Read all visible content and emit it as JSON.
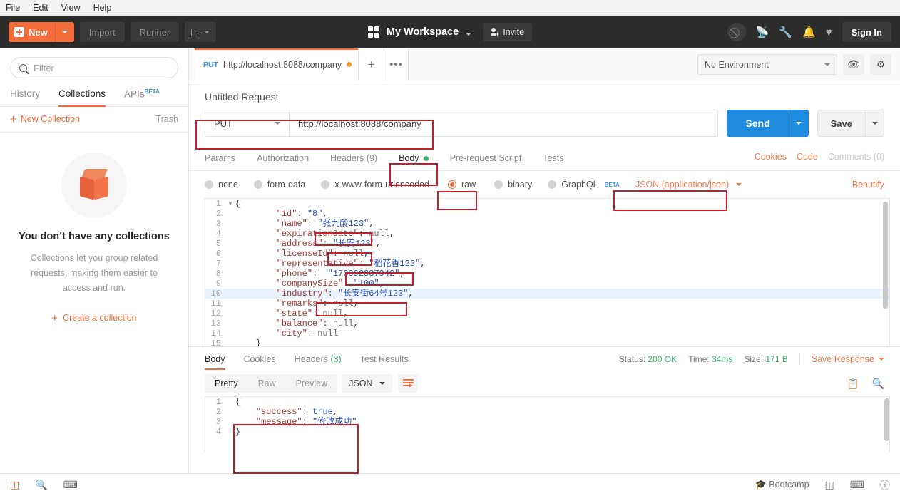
{
  "menubar": {
    "items": [
      "File",
      "Edit",
      "View",
      "Help"
    ]
  },
  "header": {
    "new_label": "New",
    "import_label": "Import",
    "runner_label": "Runner",
    "workspace_label": "My Workspace",
    "invite_label": "Invite",
    "signin_label": "Sign In",
    "icons": [
      "sync-disabled-icon",
      "satellite-icon",
      "wrench-icon",
      "bell-icon",
      "heart-icon"
    ]
  },
  "sidebar": {
    "filter_placeholder": "Filter",
    "tabs": [
      {
        "label": "History",
        "active": false
      },
      {
        "label": "Collections",
        "active": true
      },
      {
        "label": "APIs",
        "badge": "BETA",
        "active": false
      }
    ],
    "new_collection_label": "New Collection",
    "trash_label": "Trash",
    "empty_title": "You don’t have any collections",
    "empty_body": "Collections let you group related requests, making them easier to access and run.",
    "create_label": "Create a collection"
  },
  "tabbar": {
    "request_tab": {
      "method": "PUT",
      "url": "http://localhost:8088/company",
      "unsaved": true
    },
    "add_label": "+",
    "more_label": "•••",
    "environment": "No Environment",
    "eye_icon": "eye-icon",
    "gear_icon": "gear-icon"
  },
  "request": {
    "name": "Untitled Request",
    "method": "PUT",
    "url": "http://localhost:8088/company",
    "send_label": "Send",
    "save_label": "Save",
    "tabs": [
      {
        "label": "Params",
        "active": false
      },
      {
        "label": "Authorization",
        "active": false
      },
      {
        "label": "Headers",
        "count": "(9)",
        "active": false
      },
      {
        "label": "Body",
        "active": true,
        "dot": true
      },
      {
        "label": "Pre-request Script",
        "active": false
      },
      {
        "label": "Tests",
        "active": false
      }
    ],
    "right_links": [
      {
        "label": "Cookies",
        "muted": false
      },
      {
        "label": "Code",
        "muted": false
      },
      {
        "label": "Comments (0)",
        "muted": true
      }
    ],
    "body_types": [
      {
        "label": "none",
        "selected": false
      },
      {
        "label": "form-data",
        "selected": false
      },
      {
        "label": "x-www-form-urlencoded",
        "selected": false
      },
      {
        "label": "raw",
        "selected": true
      },
      {
        "label": "binary",
        "selected": false
      },
      {
        "label": "GraphQL",
        "badge": "BETA",
        "selected": false
      }
    ],
    "content_type": "JSON (application/json)",
    "beautify_label": "Beautify",
    "body_lines": [
      {
        "n": "1",
        "fold": "▾",
        "segs": [
          {
            "t": "{",
            "c": "p"
          }
        ]
      },
      {
        "n": "2",
        "segs": [
          {
            "t": "        ",
            "c": "p"
          },
          {
            "t": "\"id\"",
            "c": "k"
          },
          {
            "t": ": ",
            "c": "p"
          },
          {
            "t": "\"8\"",
            "c": "s"
          },
          {
            "t": ",",
            "c": "p"
          }
        ]
      },
      {
        "n": "3",
        "segs": [
          {
            "t": "        ",
            "c": "p"
          },
          {
            "t": "\"name\"",
            "c": "k"
          },
          {
            "t": ": ",
            "c": "p"
          },
          {
            "t": "\"张九龄123\"",
            "c": "s"
          },
          {
            "t": ",",
            "c": "p"
          }
        ]
      },
      {
        "n": "4",
        "segs": [
          {
            "t": "        ",
            "c": "p"
          },
          {
            "t": "\"expirationDate\"",
            "c": "k"
          },
          {
            "t": ": ",
            "c": "p"
          },
          {
            "t": "null",
            "c": "n"
          },
          {
            "t": ",",
            "c": "p"
          }
        ]
      },
      {
        "n": "5",
        "segs": [
          {
            "t": "        ",
            "c": "p"
          },
          {
            "t": "\"address\"",
            "c": "k"
          },
          {
            "t": ": ",
            "c": "p"
          },
          {
            "t": "\"长安123\"",
            "c": "s"
          },
          {
            "t": ",",
            "c": "p"
          }
        ]
      },
      {
        "n": "6",
        "segs": [
          {
            "t": "        ",
            "c": "p"
          },
          {
            "t": "\"licenseId\"",
            "c": "k"
          },
          {
            "t": ": ",
            "c": "p"
          },
          {
            "t": "null",
            "c": "n"
          },
          {
            "t": ",",
            "c": "p"
          }
        ]
      },
      {
        "n": "7",
        "segs": [
          {
            "t": "        ",
            "c": "p"
          },
          {
            "t": "\"representative\"",
            "c": "k"
          },
          {
            "t": ": ",
            "c": "p"
          },
          {
            "t": "\"稻花香123\"",
            "c": "s"
          },
          {
            "t": ",",
            "c": "p"
          }
        ]
      },
      {
        "n": "8",
        "segs": [
          {
            "t": "        ",
            "c": "p"
          },
          {
            "t": "\"phone\"",
            "c": "k"
          },
          {
            "t": ":  ",
            "c": "p"
          },
          {
            "t": "\"173092387942\"",
            "c": "s"
          },
          {
            "t": ",",
            "c": "p"
          }
        ]
      },
      {
        "n": "9",
        "segs": [
          {
            "t": "        ",
            "c": "p"
          },
          {
            "t": "\"companySize\"",
            "c": "k"
          },
          {
            "t": ": ",
            "c": "p"
          },
          {
            "t": "\"100\"",
            "c": "s"
          },
          {
            "t": ",",
            "c": "p"
          }
        ]
      },
      {
        "n": "10",
        "hl": true,
        "segs": [
          {
            "t": "        ",
            "c": "p"
          },
          {
            "t": "\"industry\"",
            "c": "k"
          },
          {
            "t": ": ",
            "c": "p"
          },
          {
            "t": "\"长安街64号123\"",
            "c": "s"
          },
          {
            "t": ",",
            "c": "p"
          }
        ]
      },
      {
        "n": "11",
        "segs": [
          {
            "t": "        ",
            "c": "p"
          },
          {
            "t": "\"remarks\"",
            "c": "k"
          },
          {
            "t": ": ",
            "c": "p"
          },
          {
            "t": "null",
            "c": "n"
          },
          {
            "t": ",",
            "c": "p"
          }
        ]
      },
      {
        "n": "12",
        "segs": [
          {
            "t": "        ",
            "c": "p"
          },
          {
            "t": "\"state\"",
            "c": "k"
          },
          {
            "t": ": ",
            "c": "p"
          },
          {
            "t": "null",
            "c": "n"
          },
          {
            "t": ",",
            "c": "p"
          }
        ]
      },
      {
        "n": "13",
        "segs": [
          {
            "t": "        ",
            "c": "p"
          },
          {
            "t": "\"balance\"",
            "c": "k"
          },
          {
            "t": ": ",
            "c": "p"
          },
          {
            "t": "null",
            "c": "n"
          },
          {
            "t": ",",
            "c": "p"
          }
        ]
      },
      {
        "n": "14",
        "segs": [
          {
            "t": "        ",
            "c": "p"
          },
          {
            "t": "\"city\"",
            "c": "k"
          },
          {
            "t": ": ",
            "c": "p"
          },
          {
            "t": "null",
            "c": "n"
          }
        ]
      },
      {
        "n": "15",
        "segs": [
          {
            "t": "    }",
            "c": "p"
          }
        ]
      }
    ]
  },
  "response": {
    "tabs": [
      {
        "label": "Body",
        "active": true
      },
      {
        "label": "Cookies",
        "active": false
      },
      {
        "label": "Headers",
        "count": "(3)",
        "active": false
      },
      {
        "label": "Test Results",
        "active": false
      }
    ],
    "status_label": "Status:",
    "status_value": "200 OK",
    "time_label": "Time:",
    "time_value": "34ms",
    "size_label": "Size:",
    "size_value": "171 B",
    "save_response_label": "Save Response",
    "view_modes": [
      {
        "label": "Pretty",
        "active": true
      },
      {
        "label": "Raw",
        "active": false
      },
      {
        "label": "Preview",
        "active": false
      }
    ],
    "format": "JSON",
    "wrap_icon": "word-wrap-icon",
    "copy_icon": "copy-icon",
    "search_icon": "search-icon",
    "body_lines": [
      {
        "n": "1",
        "segs": [
          {
            "t": "{",
            "c": "p"
          }
        ]
      },
      {
        "n": "2",
        "segs": [
          {
            "t": "    ",
            "c": "p"
          },
          {
            "t": "\"success\"",
            "c": "k"
          },
          {
            "t": ": ",
            "c": "p"
          },
          {
            "t": "true",
            "c": "b"
          },
          {
            "t": ",",
            "c": "p"
          }
        ]
      },
      {
        "n": "3",
        "segs": [
          {
            "t": "    ",
            "c": "p"
          },
          {
            "t": "\"message\"",
            "c": "k"
          },
          {
            "t": ": ",
            "c": "p"
          },
          {
            "t": "\"修改成功\"",
            "c": "s"
          }
        ]
      },
      {
        "n": "4",
        "segs": [
          {
            "t": "}",
            "c": "p"
          }
        ]
      }
    ]
  },
  "statusbar": {
    "left_icons": [
      "sidebar-toggle-icon",
      "find-icon",
      "console-icon"
    ],
    "bootcamp_label": "Bootcamp",
    "right_icons": [
      "two-pane-icon",
      "keyboard-icon",
      "help-icon"
    ]
  },
  "colors": {
    "accent": "#f26b3a",
    "send_blue": "#1f8ce0",
    "status_green": "#3bb273",
    "annotation_red": "#c0202a"
  },
  "annotations": [
    {
      "name": "url-bar-highlight"
    },
    {
      "name": "body-tab-highlight"
    },
    {
      "name": "raw-radio-highlight"
    },
    {
      "name": "content-type-highlight"
    },
    {
      "name": "name-value-highlight"
    },
    {
      "name": "address-value-highlight"
    },
    {
      "name": "representative-value-highlight"
    },
    {
      "name": "industry-value-highlight"
    },
    {
      "name": "response-body-highlight"
    }
  ]
}
